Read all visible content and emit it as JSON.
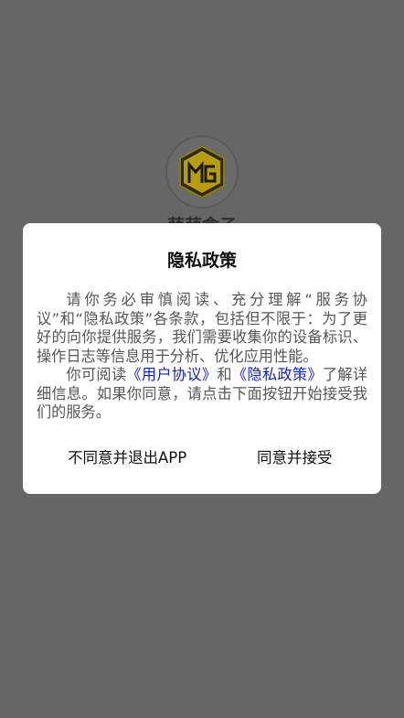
{
  "splash": {
    "app_name": "萌萌盒子",
    "logo_text": "MG"
  },
  "dialog": {
    "title": "隐私政策",
    "paragraph1": "请你务必审慎阅读、充分理解“服务协议”和“隐私政策”各条款，包括但不限于：为了更好的向你提供服务，我们需要收集你的设备标识、操作日志等信息用于分析、优化应用性能。",
    "p2_before": "你可阅读",
    "p2_link_user_agreement": "《用户协议》",
    "p2_and": "和",
    "p2_link_privacy_policy": "《隐私政策》",
    "p2_after": "了解详细信息。如果你同意，请点击下面按钮开始接受我们的服务。",
    "decline_label": "不同意并退出APP",
    "accept_label": "同意并接受"
  },
  "colors": {
    "backdrop": "#666666",
    "dialog_bg": "#ffffff",
    "link": "#1a23b0",
    "logo_gold": "#b59c10"
  }
}
